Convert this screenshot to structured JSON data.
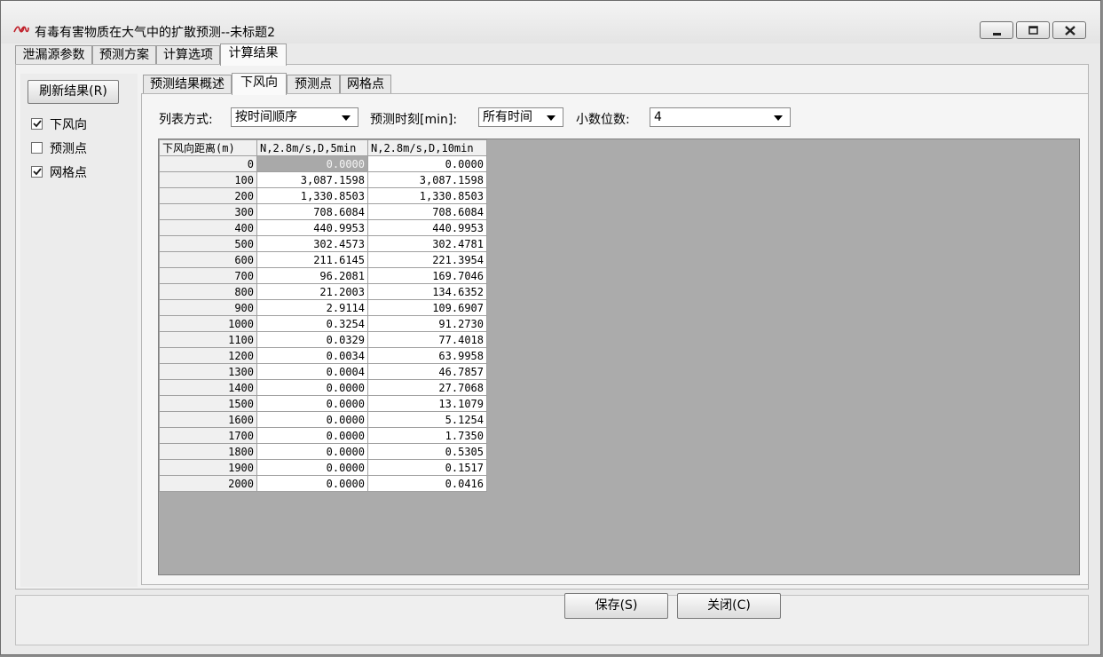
{
  "window": {
    "title": "有毒有害物质在大气中的扩散预测--未标题2",
    "icon": "app-logo-icon",
    "controls": [
      "minimize-icon",
      "maximize-icon",
      "close-icon"
    ]
  },
  "main_tabs": [
    {
      "label": "泄漏源参数",
      "active": false
    },
    {
      "label": "预测方案",
      "active": false
    },
    {
      "label": "计算选项",
      "active": false
    },
    {
      "label": "计算结果",
      "active": true
    }
  ],
  "left": {
    "refresh_label": "刷新结果(R)",
    "checks": [
      {
        "label": "下风向",
        "checked": true
      },
      {
        "label": "预测点",
        "checked": false
      },
      {
        "label": "网格点",
        "checked": true
      }
    ]
  },
  "sub_tabs": [
    {
      "label": "预测结果概述",
      "active": false
    },
    {
      "label": "下风向",
      "active": true
    },
    {
      "label": "预测点",
      "active": false
    },
    {
      "label": "网格点",
      "active": false
    }
  ],
  "filters": {
    "list_mode_label": "列表方式:",
    "list_mode_value": "按时间顺序",
    "time_label": "预测时刻[min]:",
    "time_value": "所有时间",
    "decimals_label": "小数位数:",
    "decimals_value": "4"
  },
  "table": {
    "headers": [
      "下风向距离(m)",
      "N,2.8m/s,D,5min",
      "N,2.8m/s,D,10min"
    ],
    "rows": [
      [
        "0",
        "0.0000",
        "0.0000"
      ],
      [
        "100",
        "3,087.1598",
        "3,087.1598"
      ],
      [
        "200",
        "1,330.8503",
        "1,330.8503"
      ],
      [
        "300",
        "708.6084",
        "708.6084"
      ],
      [
        "400",
        "440.9953",
        "440.9953"
      ],
      [
        "500",
        "302.4573",
        "302.4781"
      ],
      [
        "600",
        "211.6145",
        "221.3954"
      ],
      [
        "700",
        "96.2081",
        "169.7046"
      ],
      [
        "800",
        "21.2003",
        "134.6352"
      ],
      [
        "900",
        "2.9114",
        "109.6907"
      ],
      [
        "1000",
        "0.3254",
        "91.2730"
      ],
      [
        "1100",
        "0.0329",
        "77.4018"
      ],
      [
        "1200",
        "0.0034",
        "63.9958"
      ],
      [
        "1300",
        "0.0004",
        "46.7857"
      ],
      [
        "1400",
        "0.0000",
        "27.7068"
      ],
      [
        "1500",
        "0.0000",
        "13.1079"
      ],
      [
        "1600",
        "0.0000",
        "5.1254"
      ],
      [
        "1700",
        "0.0000",
        "1.7350"
      ],
      [
        "1800",
        "0.0000",
        "0.5305"
      ],
      [
        "1900",
        "0.0000",
        "0.1517"
      ],
      [
        "2000",
        "0.0000",
        "0.0416"
      ]
    ]
  },
  "footer": {
    "save_label": "保存(S)",
    "close_label": "关闭(C)"
  },
  "colors": {
    "selected_cell": "#a9a9a9",
    "grid_background": "#ababab"
  }
}
